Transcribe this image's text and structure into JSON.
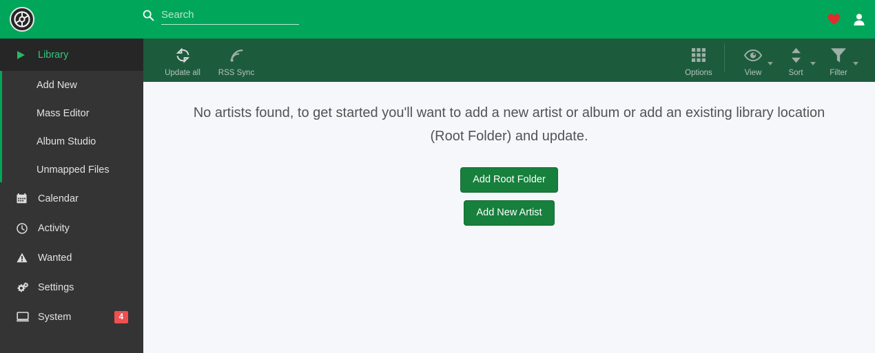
{
  "header": {
    "logo_icon": "lidarr-logo-icon",
    "search": {
      "value": "",
      "placeholder": "Search",
      "icon": "search-icon"
    },
    "donate_icon": "heart-icon",
    "account_icon": "user-icon"
  },
  "sidebar": {
    "groups": [
      {
        "label": "Library",
        "icon": "play-icon",
        "active": true,
        "children": [
          {
            "label": "Add New"
          },
          {
            "label": "Mass Editor"
          },
          {
            "label": "Album Studio"
          },
          {
            "label": "Unmapped Files"
          }
        ]
      }
    ],
    "items": [
      {
        "label": "Calendar",
        "icon": "calendar-icon",
        "badge": ""
      },
      {
        "label": "Activity",
        "icon": "clock-icon",
        "badge": ""
      },
      {
        "label": "Wanted",
        "icon": "warning-triangle-icon",
        "badge": ""
      },
      {
        "label": "Settings",
        "icon": "gears-icon",
        "badge": ""
      },
      {
        "label": "System",
        "icon": "monitor-icon",
        "badge": "4"
      }
    ]
  },
  "toolbar": {
    "left": [
      {
        "label": "Update all",
        "icon": "refresh-icon"
      },
      {
        "label": "RSS Sync",
        "icon": "rss-icon"
      }
    ],
    "right": [
      {
        "label": "Options",
        "icon": "grid-icon",
        "caret": false
      },
      {
        "label": "View",
        "icon": "eye-icon",
        "caret": true
      },
      {
        "label": "Sort",
        "icon": "sort-arrows-icon",
        "caret": true
      },
      {
        "label": "Filter",
        "icon": "funnel-icon",
        "caret": true
      }
    ]
  },
  "main": {
    "message": "No artists found, to get started you'll want to add a new artist or album or add an existing library location (Root Folder) and update.",
    "add_root_folder_label": "Add Root Folder",
    "add_new_artist_label": "Add New Artist"
  },
  "colors": {
    "header_green": "#00a65a",
    "toolbar_green": "#1d5b3d",
    "sidebar_dark": "#343434",
    "sidebar_active": "#262626",
    "accent_green": "#35c77f",
    "button_green": "#16803c",
    "badge_red": "#f05050",
    "content_bg": "#f5f7fa",
    "heart_red": "#e22b2b"
  }
}
